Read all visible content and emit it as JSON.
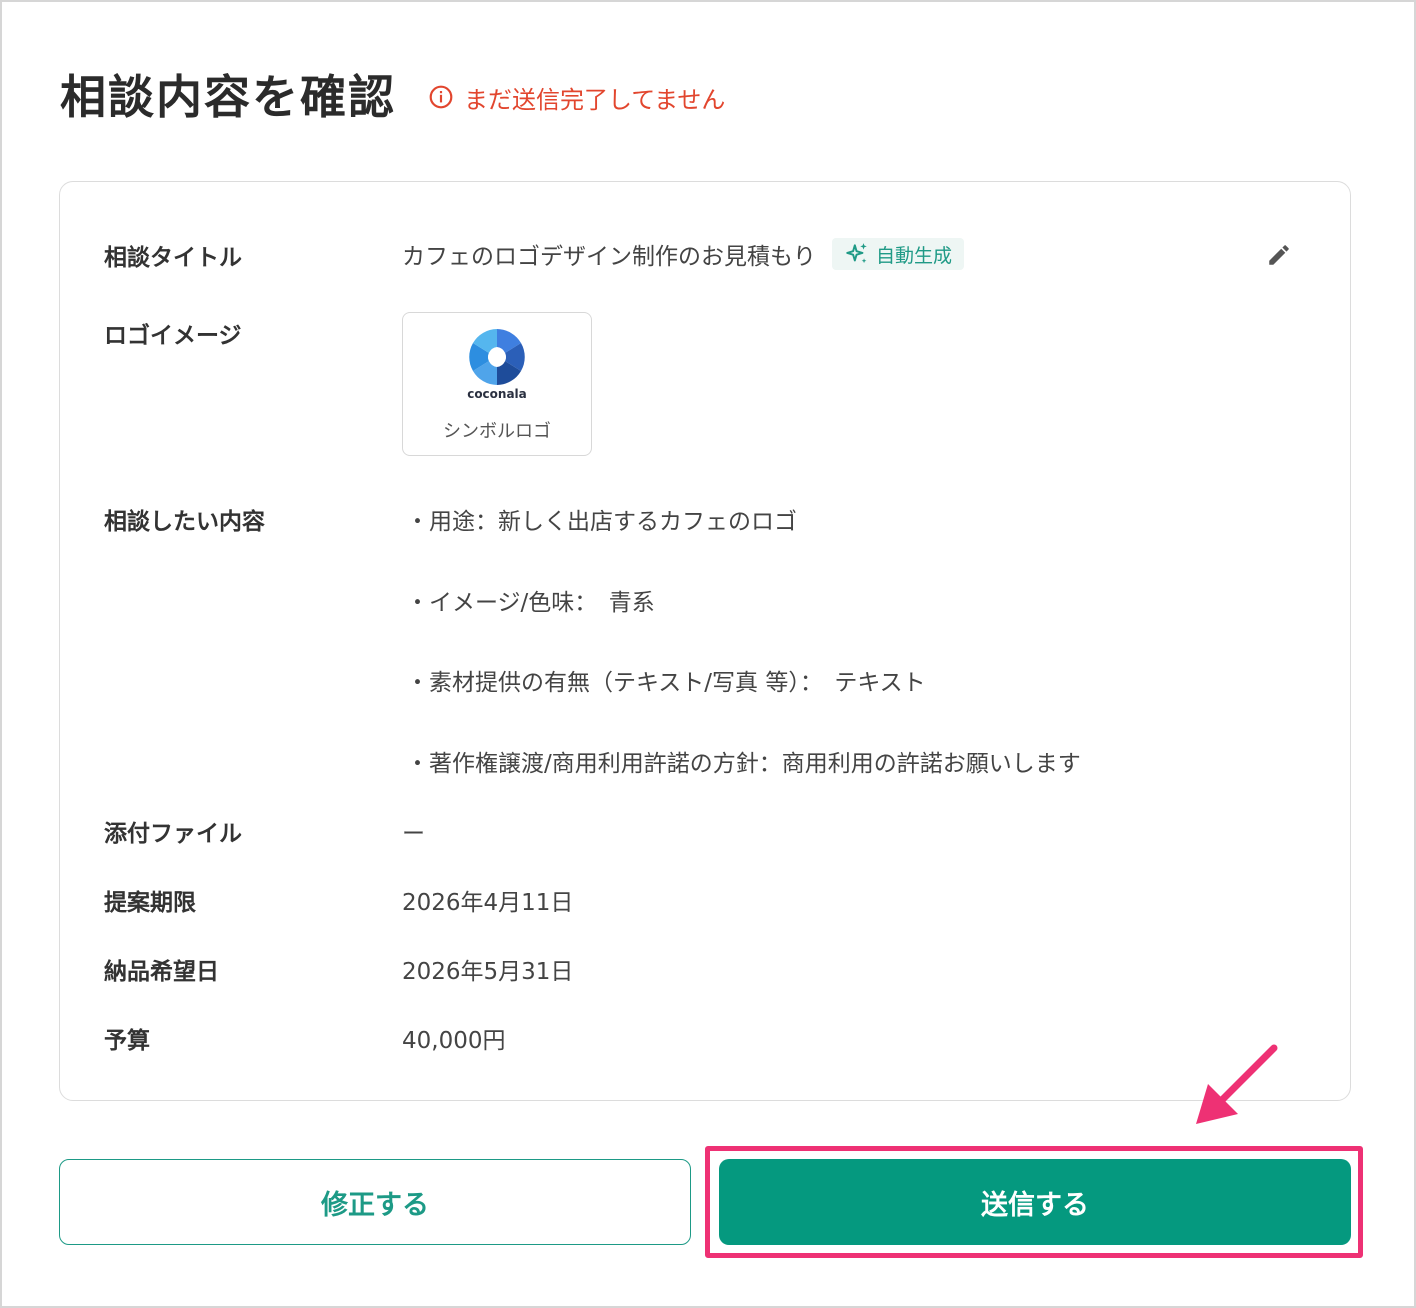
{
  "page": {
    "title": "相談内容を確認",
    "warning": "まだ送信完了してません",
    "warning_color": "#e2462e",
    "accent_color": "#05997f",
    "highlight_color": "#ee3174"
  },
  "details": {
    "title_label": "相談タイトル",
    "title_value": "カフェのロゴデザイン制作のお見積もり",
    "auto_badge": "自動生成",
    "logo_label": "ロゴイメージ",
    "logo_wordmark": "coconala",
    "logo_caption": "シンボルロゴ",
    "content_label": "相談したい内容",
    "content_lines": [
      "・用途：新しく出店するカフェのロゴ",
      "・イメージ/色味：　青系",
      "・素材提供の有無（テキスト/写真 等）：　テキスト",
      "・著作権譲渡/商用利用許諾の方針：商用利用の許諾お願いします"
    ],
    "attachment_label": "添付ファイル",
    "attachment_value": "ー",
    "deadline_label": "提案期限",
    "deadline_value": "2026年4月11日",
    "delivery_label": "納品希望日",
    "delivery_value": "2026年5月31日",
    "budget_label": "予算",
    "budget_value": "40,000円"
  },
  "actions": {
    "edit_label": "修正する",
    "send_label": "送信する"
  },
  "icons": {
    "warning": "info-circle-icon",
    "auto": "sparkle-icon",
    "edit": "pencil-icon",
    "pointer": "arrow-icon"
  }
}
